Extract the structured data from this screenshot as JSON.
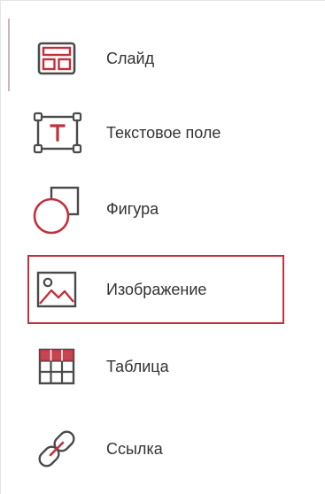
{
  "menu": {
    "items": [
      {
        "label": "Слайд",
        "icon": "slide-layout-icon"
      },
      {
        "label": "Текстовое поле",
        "icon": "text-box-icon"
      },
      {
        "label": "Фигура",
        "icon": "shape-icon"
      },
      {
        "label": "Изображение",
        "icon": "image-icon",
        "selected": true
      },
      {
        "label": "Таблица",
        "icon": "table-icon"
      },
      {
        "label": "Ссылка",
        "icon": "link-icon"
      }
    ]
  },
  "colors": {
    "accent": "#c0313d",
    "icon_dark": "#4a4a4a",
    "text": "#333333"
  }
}
